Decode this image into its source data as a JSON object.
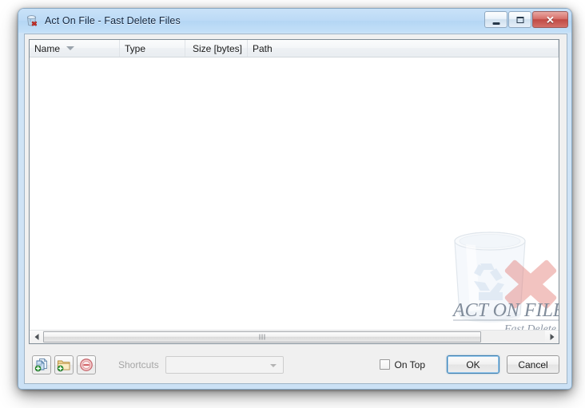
{
  "window": {
    "title": "Act On File - Fast Delete Files",
    "app_icon": "recycle-bin-delete-icon",
    "caption": {
      "minimize_label": "Minimize",
      "maximize_label": "Maximize",
      "close_label": "Close",
      "close_glyph": "✕"
    }
  },
  "list": {
    "columns": [
      {
        "label": "Name",
        "sorted": true,
        "sort_direction": "descending",
        "align": "left"
      },
      {
        "label": "Type",
        "sorted": false,
        "align": "left"
      },
      {
        "label": "Size [bytes]",
        "sorted": false,
        "align": "right"
      },
      {
        "label": "Path",
        "sorted": false,
        "align": "left"
      }
    ],
    "rows": [],
    "empty": true
  },
  "watermark": {
    "line1": "ACT ON FILE",
    "line2": "Fast Delete",
    "icon": "recycle-bin-with-red-x-icon"
  },
  "scrollbar": {
    "left_arrow": "scroll-left-icon",
    "right_arrow": "scroll-right-icon",
    "orientation": "horizontal"
  },
  "toolbar": {
    "add_files_label": "Add Files",
    "add_folder_label": "Add Folder",
    "remove_label": "Remove",
    "shortcuts_label": "Shortcuts",
    "shortcuts_value": "",
    "shortcuts_placeholder": "",
    "shortcuts_enabled": false
  },
  "footer": {
    "on_top_label": "On Top",
    "on_top_checked": false,
    "ok_label": "OK",
    "cancel_label": "Cancel"
  },
  "colors": {
    "frame": "#cfe3f6",
    "titlebar": "#bcdaf6",
    "close_button": "#c04a44",
    "default_button_border": "#3c7fb1",
    "client_background": "#f0f0f0",
    "list_background": "#ffffff",
    "disabled_text": "#a6a6a6"
  }
}
